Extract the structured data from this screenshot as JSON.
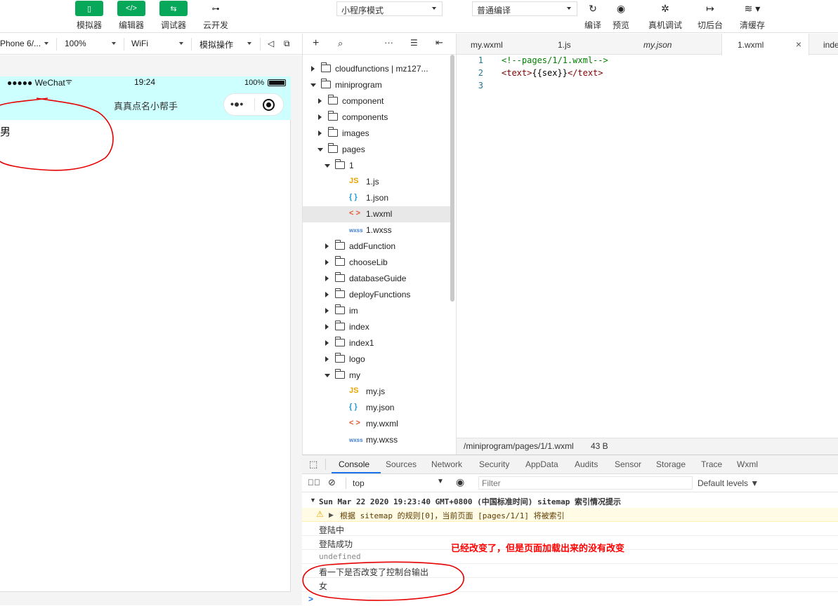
{
  "toolbar": {
    "simulator": "模拟器",
    "editor": "编辑器",
    "debugger": "调试器",
    "cloud": "云开发",
    "mode_select": "小程序模式",
    "compile_select": "普通编译",
    "compile": "编译",
    "preview": "预览",
    "remote_debug": "真机调试",
    "background": "切后台",
    "clear_cache": "清缓存"
  },
  "device_bar": {
    "device": "Phone 6/...",
    "zoom": "100%",
    "network": "WiFi",
    "operation": "模拟操作"
  },
  "phone": {
    "carrier": "●●●●● WeChat",
    "time": "19:24",
    "battery": "100%",
    "nav_title": "真真点名小帮手",
    "capsule_dots": "•●•",
    "content_text": "男"
  },
  "explorer": {
    "tree": [
      {
        "label": "cloudfunctions | mz127...",
        "kind": "cloud",
        "depth": 0,
        "state": "collapsed"
      },
      {
        "label": "miniprogram",
        "kind": "folder",
        "depth": 0,
        "state": "expanded"
      },
      {
        "label": "component",
        "kind": "folder",
        "depth": 1,
        "state": "collapsed"
      },
      {
        "label": "components",
        "kind": "folder",
        "depth": 1,
        "state": "collapsed"
      },
      {
        "label": "images",
        "kind": "folder",
        "depth": 1,
        "state": "collapsed"
      },
      {
        "label": "pages",
        "kind": "folder",
        "depth": 1,
        "state": "expanded"
      },
      {
        "label": "1",
        "kind": "folder",
        "depth": 2,
        "state": "expanded"
      },
      {
        "label": "1.js",
        "kind": "js",
        "depth": 3
      },
      {
        "label": "1.json",
        "kind": "json",
        "depth": 3
      },
      {
        "label": "1.wxml",
        "kind": "wxml",
        "depth": 3,
        "selected": true
      },
      {
        "label": "1.wxss",
        "kind": "wxss",
        "depth": 3
      },
      {
        "label": "addFunction",
        "kind": "folder",
        "depth": 2,
        "state": "collapsed"
      },
      {
        "label": "chooseLib",
        "kind": "folder",
        "depth": 2,
        "state": "collapsed"
      },
      {
        "label": "databaseGuide",
        "kind": "folder",
        "depth": 2,
        "state": "collapsed"
      },
      {
        "label": "deployFunctions",
        "kind": "folder",
        "depth": 2,
        "state": "collapsed"
      },
      {
        "label": "im",
        "kind": "folder",
        "depth": 2,
        "state": "collapsed"
      },
      {
        "label": "index",
        "kind": "folder",
        "depth": 2,
        "state": "collapsed"
      },
      {
        "label": "index1",
        "kind": "folder",
        "depth": 2,
        "state": "collapsed"
      },
      {
        "label": "logo",
        "kind": "folder",
        "depth": 2,
        "state": "collapsed"
      },
      {
        "label": "my",
        "kind": "folder",
        "depth": 2,
        "state": "expanded"
      },
      {
        "label": "my.js",
        "kind": "js",
        "depth": 3
      },
      {
        "label": "my.json",
        "kind": "json",
        "depth": 3
      },
      {
        "label": "my.wxml",
        "kind": "wxml",
        "depth": 3
      },
      {
        "label": "my.wxss",
        "kind": "wxss",
        "depth": 3
      }
    ],
    "icons": {
      "js": "JS",
      "json": "{ }",
      "wxml": "< >",
      "wxss": "wxss"
    }
  },
  "editor": {
    "tabs": [
      "my.wxml",
      "1.js",
      "my.json",
      "1.wxml",
      "inde"
    ],
    "active_tab": "1.wxml",
    "lines": [
      {
        "num": "1",
        "parts": [
          {
            "t": "<!--pages/1/1.wxml-->",
            "c": "#008000"
          }
        ]
      },
      {
        "num": "2",
        "parts": [
          {
            "t": "<text>",
            "c": "#800000"
          },
          {
            "t": "{{sex}}",
            "c": "#000000"
          },
          {
            "t": "</text>",
            "c": "#800000"
          }
        ]
      },
      {
        "num": "3",
        "parts": []
      }
    ],
    "status_path": "/miniprogram/pages/1/1.wxml",
    "status_size": "43 B"
  },
  "devtools": {
    "tabs": [
      "Console",
      "Sources",
      "Network",
      "Security",
      "AppData",
      "Audits",
      "Sensor",
      "Storage",
      "Trace",
      "Wxml"
    ],
    "active_tab": "Console",
    "context": "top",
    "filter_placeholder": "Filter",
    "levels": "Default levels ▼",
    "console": {
      "group_header": "Sun Mar 22 2020 19:23:40 GMT+0800 (中国标准时间) sitemap 索引情况提示",
      "warning": "根据 sitemap 的规则[0]，当前页面 [pages/1/1] 将被索引",
      "logs": [
        "登陆中",
        "登陆成功",
        "undefined",
        "看一下是否改变了控制台输出",
        "女"
      ],
      "prompt": ">"
    }
  },
  "annotation": "已经改变了，但是页面加载出来的没有改变",
  "colors": {
    "green": "#07a85a",
    "nav_bg": "#ccfffd",
    "annotation": "#ff0000"
  }
}
